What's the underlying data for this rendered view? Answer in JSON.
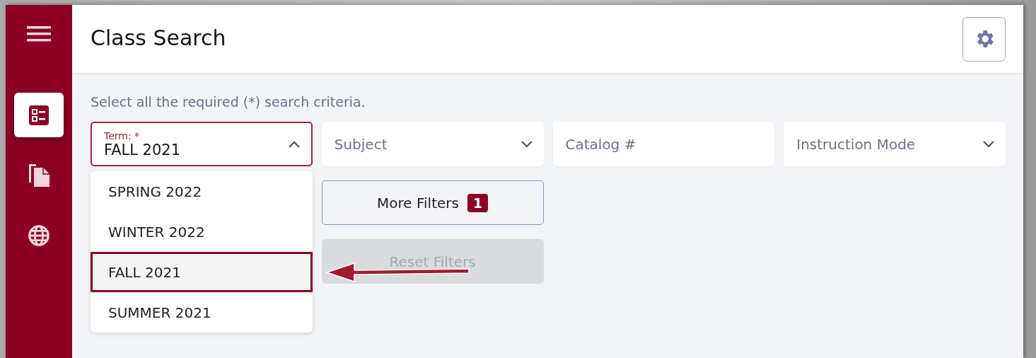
{
  "sidebar": {
    "items": [
      {
        "kind": "search",
        "selected": true
      },
      {
        "kind": "documents",
        "selected": false
      },
      {
        "kind": "globe",
        "selected": false
      }
    ]
  },
  "header": {
    "title": "Class Search"
  },
  "instructions": "Select all the required (*) search criteria.",
  "fields": [
    {
      "kind": "select",
      "label": "Term:",
      "required": "*",
      "value": "FALL 2021",
      "expanded": true,
      "options": [
        {
          "label": "SPRING 2022",
          "selected": false
        },
        {
          "label": "WINTER 2022",
          "selected": false
        },
        {
          "label": "FALL 2021",
          "selected": true
        },
        {
          "label": "SUMMER 2021",
          "selected": false
        }
      ]
    },
    {
      "kind": "select",
      "placeholder": "Subject",
      "expanded": false
    },
    {
      "kind": "input",
      "placeholder": "Catalog #"
    },
    {
      "kind": "select",
      "placeholder": "Instruction Mode",
      "expanded": false
    }
  ],
  "buttons": [
    {
      "label": "More Filters",
      "badge": "1",
      "disabled": false
    },
    {
      "label": "Reset Filters",
      "disabled": true
    }
  ]
}
